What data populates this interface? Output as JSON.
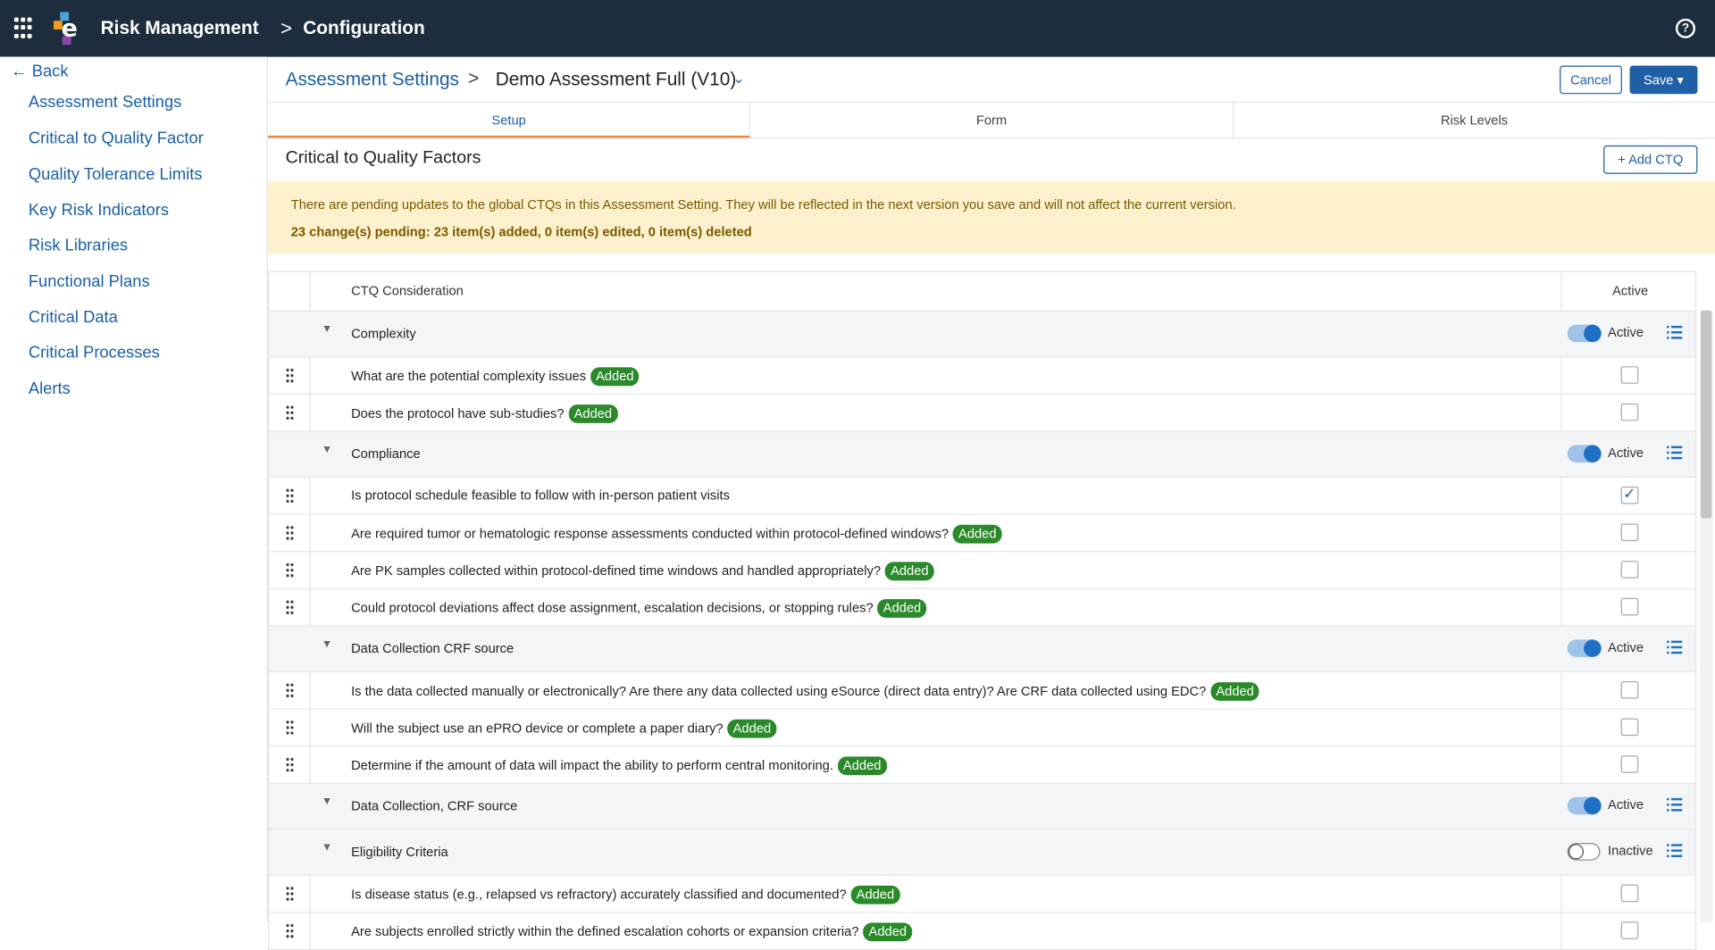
{
  "topbar": {
    "app_title": "Risk Management",
    "section": "Configuration"
  },
  "sidebar": {
    "back_label": "Back",
    "items": [
      {
        "label": "Assessment Settings"
      },
      {
        "label": "Critical to Quality Factor"
      },
      {
        "label": "Quality Tolerance Limits"
      },
      {
        "label": "Key Risk Indicators"
      },
      {
        "label": "Risk Libraries"
      },
      {
        "label": "Functional Plans"
      },
      {
        "label": "Critical Data"
      },
      {
        "label": "Critical Processes"
      },
      {
        "label": "Alerts"
      }
    ]
  },
  "header": {
    "breadcrumb_parent": "Assessment Settings",
    "breadcrumb_current": "Demo Assessment Full (V10)",
    "cancel_label": "Cancel",
    "save_label": "Save"
  },
  "tabs": [
    {
      "label": "Setup"
    },
    {
      "label": "Form"
    },
    {
      "label": "Risk Levels"
    }
  ],
  "section": {
    "title": "Critical to Quality Factors",
    "add_label": "Add CTQ"
  },
  "banner": {
    "message": "There are pending updates to the global CTQs in this Assessment Setting. They will be reflected in the next version you save and will not affect the current version.",
    "summary": "23 change(s) pending: 23 item(s) added, 0 item(s) edited, 0 item(s) deleted"
  },
  "table": {
    "col_consideration": "CTQ Consideration",
    "col_active": "Active",
    "badge_label": "Added",
    "groups": [
      {
        "name": "Complexity",
        "state": "Active",
        "active": true,
        "rows": [
          {
            "q": "What are the potential complexity issues",
            "added": true,
            "checked": false
          },
          {
            "q": "Does the protocol have sub-studies?",
            "added": true,
            "checked": false
          }
        ]
      },
      {
        "name": "Compliance",
        "state": "Active",
        "active": true,
        "rows": [
          {
            "q": "Is protocol schedule feasible to follow with in-person patient visits",
            "added": false,
            "checked": true
          },
          {
            "q": "Are required tumor or hematologic response assessments conducted within protocol-defined windows?",
            "added": true,
            "checked": false
          },
          {
            "q": "Are PK samples collected within protocol-defined time windows and handled appropriately?",
            "added": true,
            "checked": false
          },
          {
            "q": "Could protocol deviations affect dose assignment, escalation decisions, or stopping rules?",
            "added": true,
            "checked": false
          }
        ]
      },
      {
        "name": "Data Collection CRF source",
        "state": "Active",
        "active": true,
        "rows": [
          {
            "q": "Is the data collected manually or electronically? Are there any data collected using eSource (direct data entry)? Are CRF data collected using EDC?",
            "added": true,
            "checked": false
          },
          {
            "q": "Will the subject use an ePRO device or complete a paper diary?",
            "added": true,
            "checked": false
          },
          {
            "q": "Determine if the amount of data will impact the ability to perform central monitoring.",
            "added": true,
            "checked": false
          }
        ]
      },
      {
        "name": "Data Collection, CRF source",
        "state": "Active",
        "active": true,
        "rows": []
      },
      {
        "name": "Eligibility Criteria",
        "state": "Inactive",
        "active": false,
        "rows": [
          {
            "q": "Is disease status (e.g., relapsed vs refractory) accurately classified and documented?",
            "added": true,
            "checked": false
          },
          {
            "q": "Are subjects enrolled strictly within the defined escalation cohorts or expansion criteria?",
            "added": true,
            "checked": false
          }
        ]
      }
    ]
  }
}
